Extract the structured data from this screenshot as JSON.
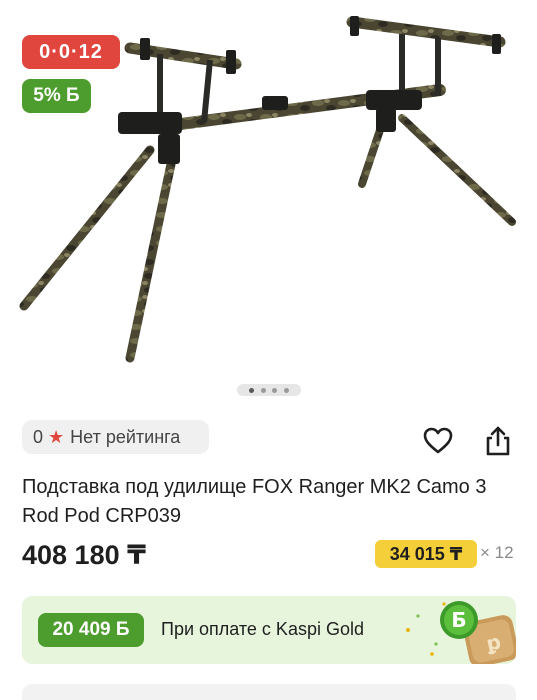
{
  "gallery": {
    "installment_badge": "0·0·12",
    "bonus_badge": "5% Б",
    "image_alt": "Подставка под удилище FOX Ranger MK2 Camo 3 Rod Pod CRP039",
    "pager": {
      "count": 4,
      "active": 1
    }
  },
  "rating": {
    "count": "0",
    "label": "Нет рейтинга"
  },
  "product": {
    "title": "Подставка под удилище FOX Ranger MK2 Camo 3 Rod Pod CRP039",
    "price": "408 180 ₸",
    "monthly_payment": "34 015 ₸",
    "months": "× 12"
  },
  "kaspi_gold": {
    "bonus": "20 409 Б",
    "text": "При оплате с Kaspi Gold",
    "coin_letter": "Б"
  },
  "icons": [
    "heart-icon",
    "share-icon",
    "star-icon"
  ],
  "colors": {
    "installment_red": "#e0463d",
    "bonus_green": "#4d9c2e",
    "monthly_yellow": "#f5cf3a",
    "gold_card_bg": "#e8f5dd"
  }
}
